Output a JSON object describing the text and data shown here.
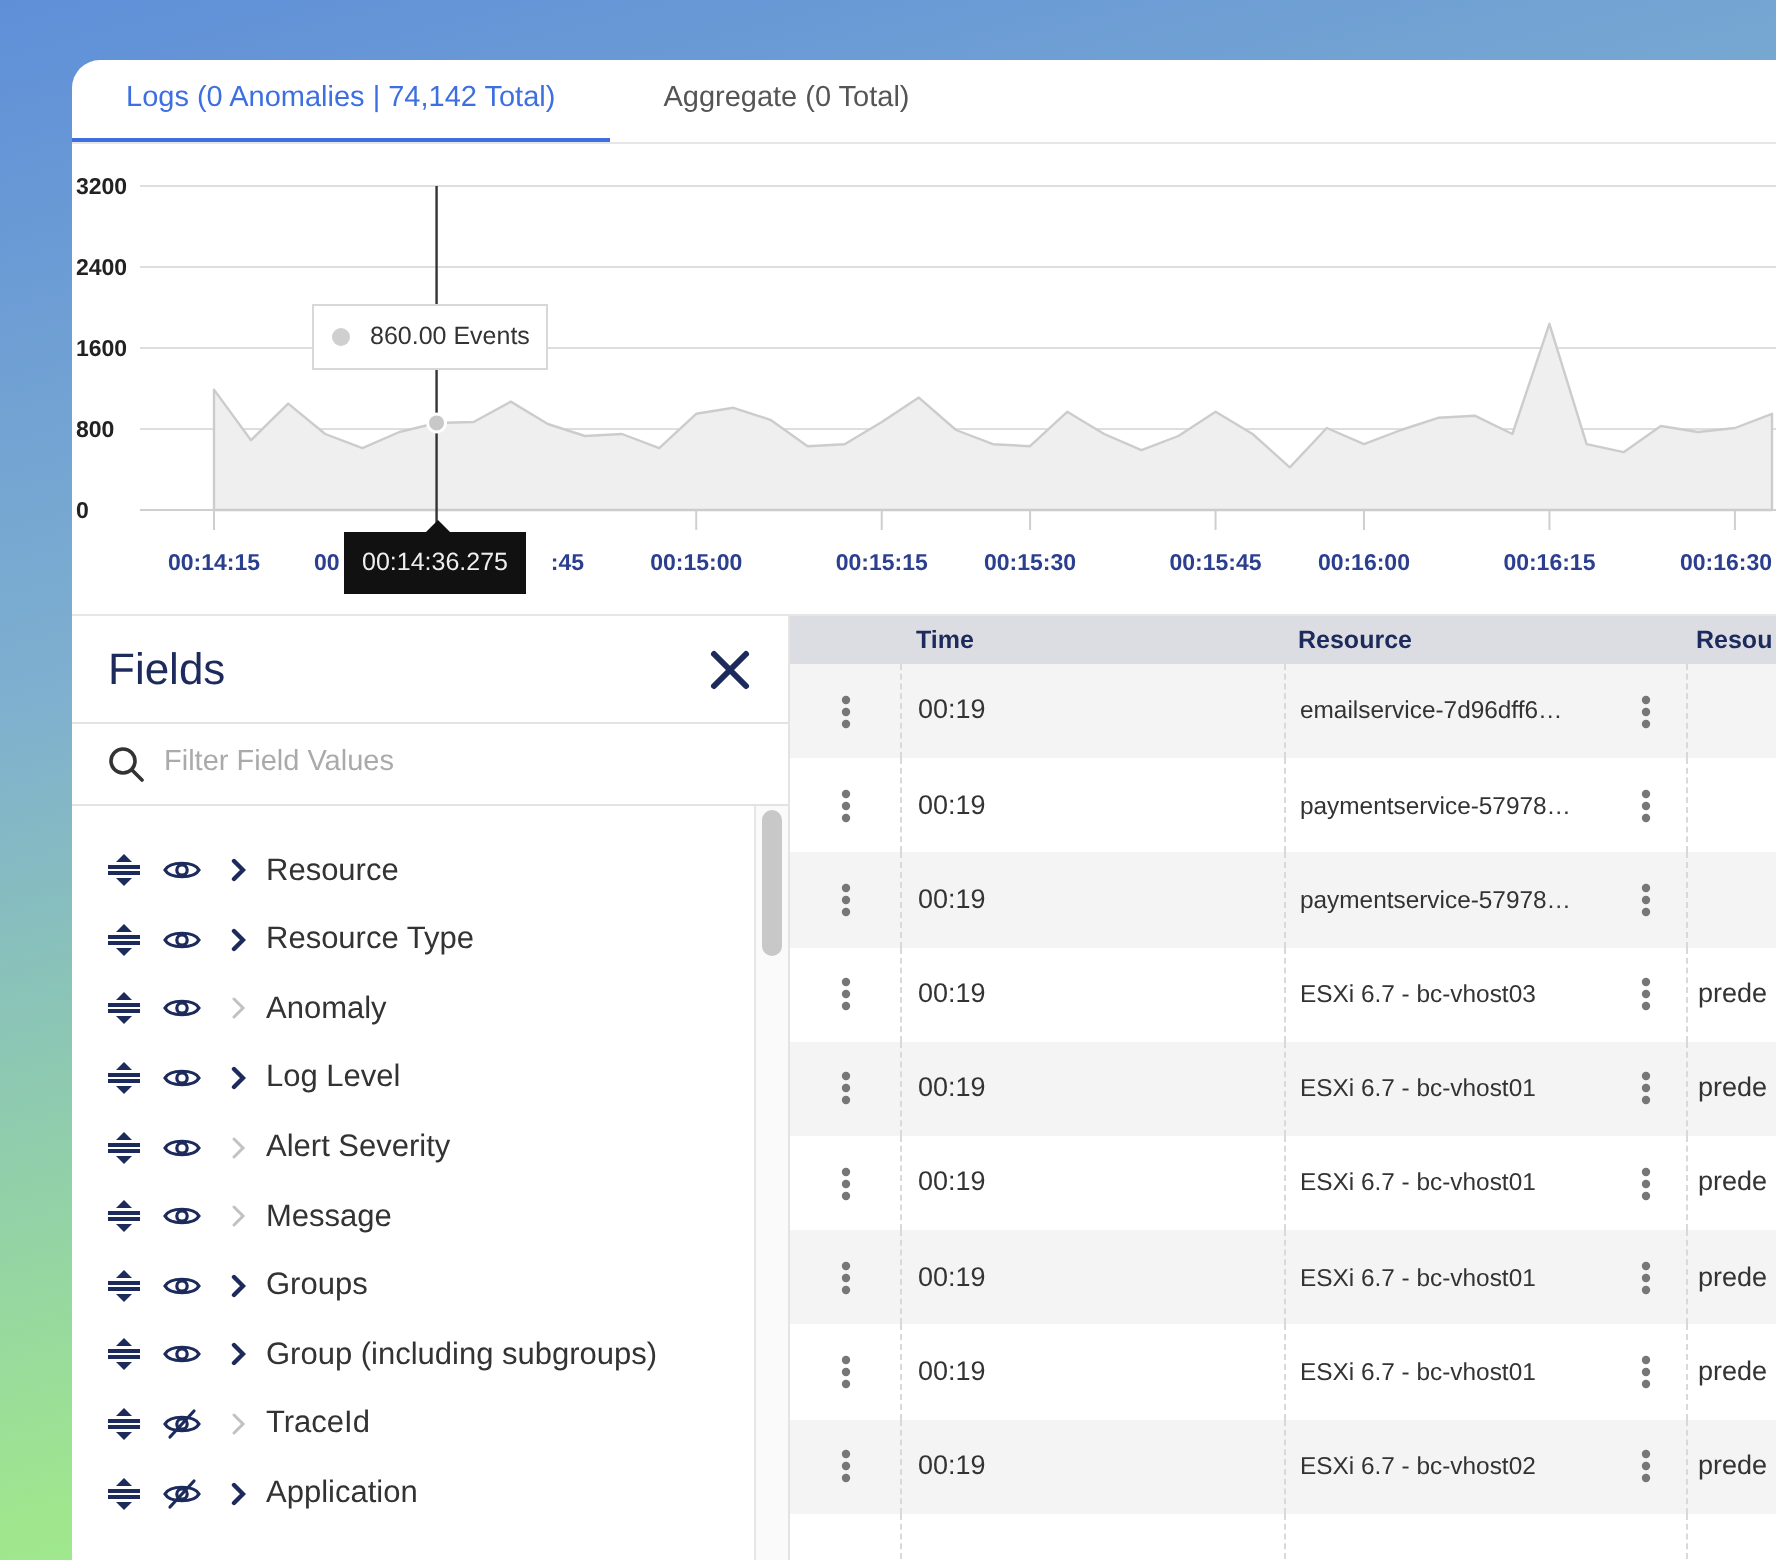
{
  "tabs": [
    {
      "label": "Logs (0 Anomalies | 74,142 Total)",
      "selected": true
    },
    {
      "label": "Aggregate (0 Total)",
      "selected": false
    }
  ],
  "chart": {
    "chart_data": {
      "type": "area",
      "categories": [
        "00:14:15",
        null,
        null,
        null,
        null,
        null,
        null,
        null,
        null,
        null,
        null,
        null,
        null,
        "00:15:00",
        null,
        null,
        null,
        null,
        "00:15:15",
        null,
        null,
        null,
        "00:15:30",
        null,
        null,
        null,
        null,
        "00:15:45",
        null,
        null,
        null,
        "00:16:00",
        null,
        null,
        null,
        null,
        "00:16:15",
        null,
        null,
        null,
        null,
        "00:16:30",
        null
      ],
      "series": [
        {
          "color": "#cccccc",
          "values": [
            1190,
            690,
            1050,
            750,
            610,
            770,
            860,
            870,
            1070,
            850,
            730,
            750,
            610,
            950,
            1010,
            890,
            630,
            650,
            870,
            1110,
            790,
            650,
            630,
            970,
            750,
            590,
            730,
            970,
            750,
            420,
            810,
            650,
            790,
            910,
            930,
            750,
            1840,
            650,
            570,
            830,
            770,
            810,
            950
          ]
        }
      ],
      "grid": true,
      "ylim": [
        0,
        3200
      ],
      "yticks": [
        0,
        800,
        1600,
        2400,
        3200
      ]
    },
    "covered_axis_labels": [
      "00",
      ":45"
    ],
    "hover": {
      "value_label": "860.00 Events",
      "time_label": "00:14:36.275"
    }
  },
  "fields_panel": {
    "title": "Fields",
    "search": {
      "placeholder": "Filter Field Values"
    },
    "fields": [
      {
        "name": "Resource",
        "visible": true,
        "expandable": true
      },
      {
        "name": "Resource Type",
        "visible": true,
        "expandable": true
      },
      {
        "name": "Anomaly",
        "visible": true,
        "expandable": false
      },
      {
        "name": "Log Level",
        "visible": true,
        "expandable": true
      },
      {
        "name": "Alert Severity",
        "visible": true,
        "expandable": false
      },
      {
        "name": "Message",
        "visible": true,
        "expandable": false
      },
      {
        "name": "Groups",
        "visible": true,
        "expandable": true
      },
      {
        "name": "Group (including subgroups)",
        "visible": true,
        "expandable": true
      },
      {
        "name": "TraceId",
        "visible": false,
        "expandable": false
      },
      {
        "name": "Application",
        "visible": false,
        "expandable": true
      }
    ]
  },
  "table": {
    "columns": [
      "Time",
      "Resource",
      "Resou"
    ],
    "rows": [
      {
        "time": "00:19",
        "resource": "emailservice-7d96dff6…"
      },
      {
        "time": "00:19",
        "resource": "paymentservice-57978…"
      },
      {
        "time": "00:19",
        "resource": "paymentservice-57978…"
      },
      {
        "time": "00:19",
        "resource": "ESXi 6.7 - bc-vhost03",
        "column_3": "prede"
      },
      {
        "time": "00:19",
        "resource": "ESXi 6.7 - bc-vhost01",
        "column_3": "prede"
      },
      {
        "time": "00:19",
        "resource": "ESXi 6.7 - bc-vhost01",
        "column_3": "prede"
      },
      {
        "time": "00:19",
        "resource": "ESXi 6.7 - bc-vhost01",
        "column_3": "prede"
      },
      {
        "time": "00:19",
        "resource": "ESXi 6.7 - bc-vhost01",
        "column_3": "prede"
      },
      {
        "time": "00:19",
        "resource": "ESXi 6.7 - bc-vhost02",
        "column_3": "prede"
      }
    ]
  }
}
